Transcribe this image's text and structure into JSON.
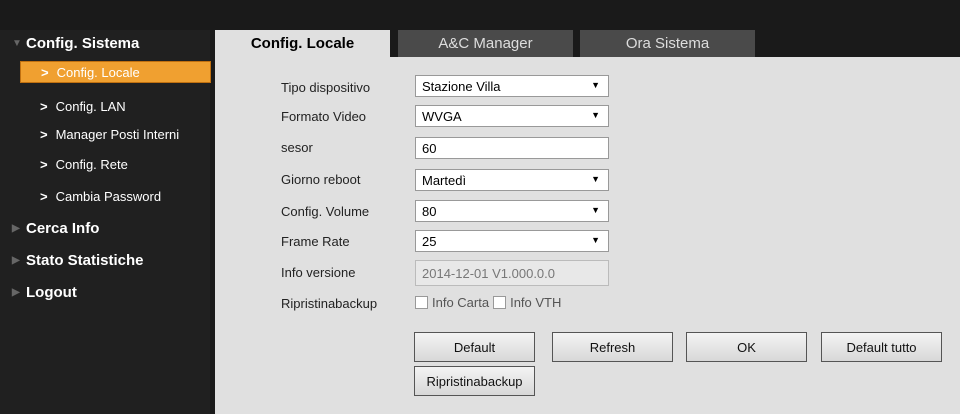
{
  "sidebar": {
    "sections": [
      {
        "label": "Config. Sistema",
        "expanded": true
      },
      {
        "label": "Cerca Info"
      },
      {
        "label": "Stato Statistiche"
      },
      {
        "label": "Logout"
      }
    ],
    "items": [
      {
        "label": "Config. Locale",
        "active": true
      },
      {
        "label": "Config. LAN"
      },
      {
        "label": "Manager Posti Interni"
      },
      {
        "label": "Config. Rete"
      },
      {
        "label": "Cambia Password"
      }
    ]
  },
  "tabs": [
    {
      "label": "Config. Locale",
      "active": true
    },
    {
      "label": "A&C Manager"
    },
    {
      "label": "Ora Sistema"
    }
  ],
  "form": {
    "tipo_dispositivo": {
      "label": "Tipo dispositivo",
      "value": "Stazione Villa"
    },
    "formato_video": {
      "label": "Formato Video",
      "value": "WVGA"
    },
    "sesor": {
      "label": "sesor",
      "value": "60"
    },
    "giorno_reboot": {
      "label": "Giorno reboot",
      "value": "Martedì"
    },
    "config_volume": {
      "label": "Config. Volume",
      "value": "80"
    },
    "frame_rate": {
      "label": "Frame Rate",
      "value": "25"
    },
    "info_versione": {
      "label": "Info versione",
      "value": "2014-12-01 V1.000.0.0"
    },
    "ripristina": {
      "label": "Ripristinabackup",
      "opt1": "Info Carta",
      "opt2": "Info VTH"
    }
  },
  "buttons": {
    "default": "Default",
    "refresh": "Refresh",
    "ok": "OK",
    "default_tutto": "Default tutto",
    "ripristina": "Ripristinabackup"
  }
}
